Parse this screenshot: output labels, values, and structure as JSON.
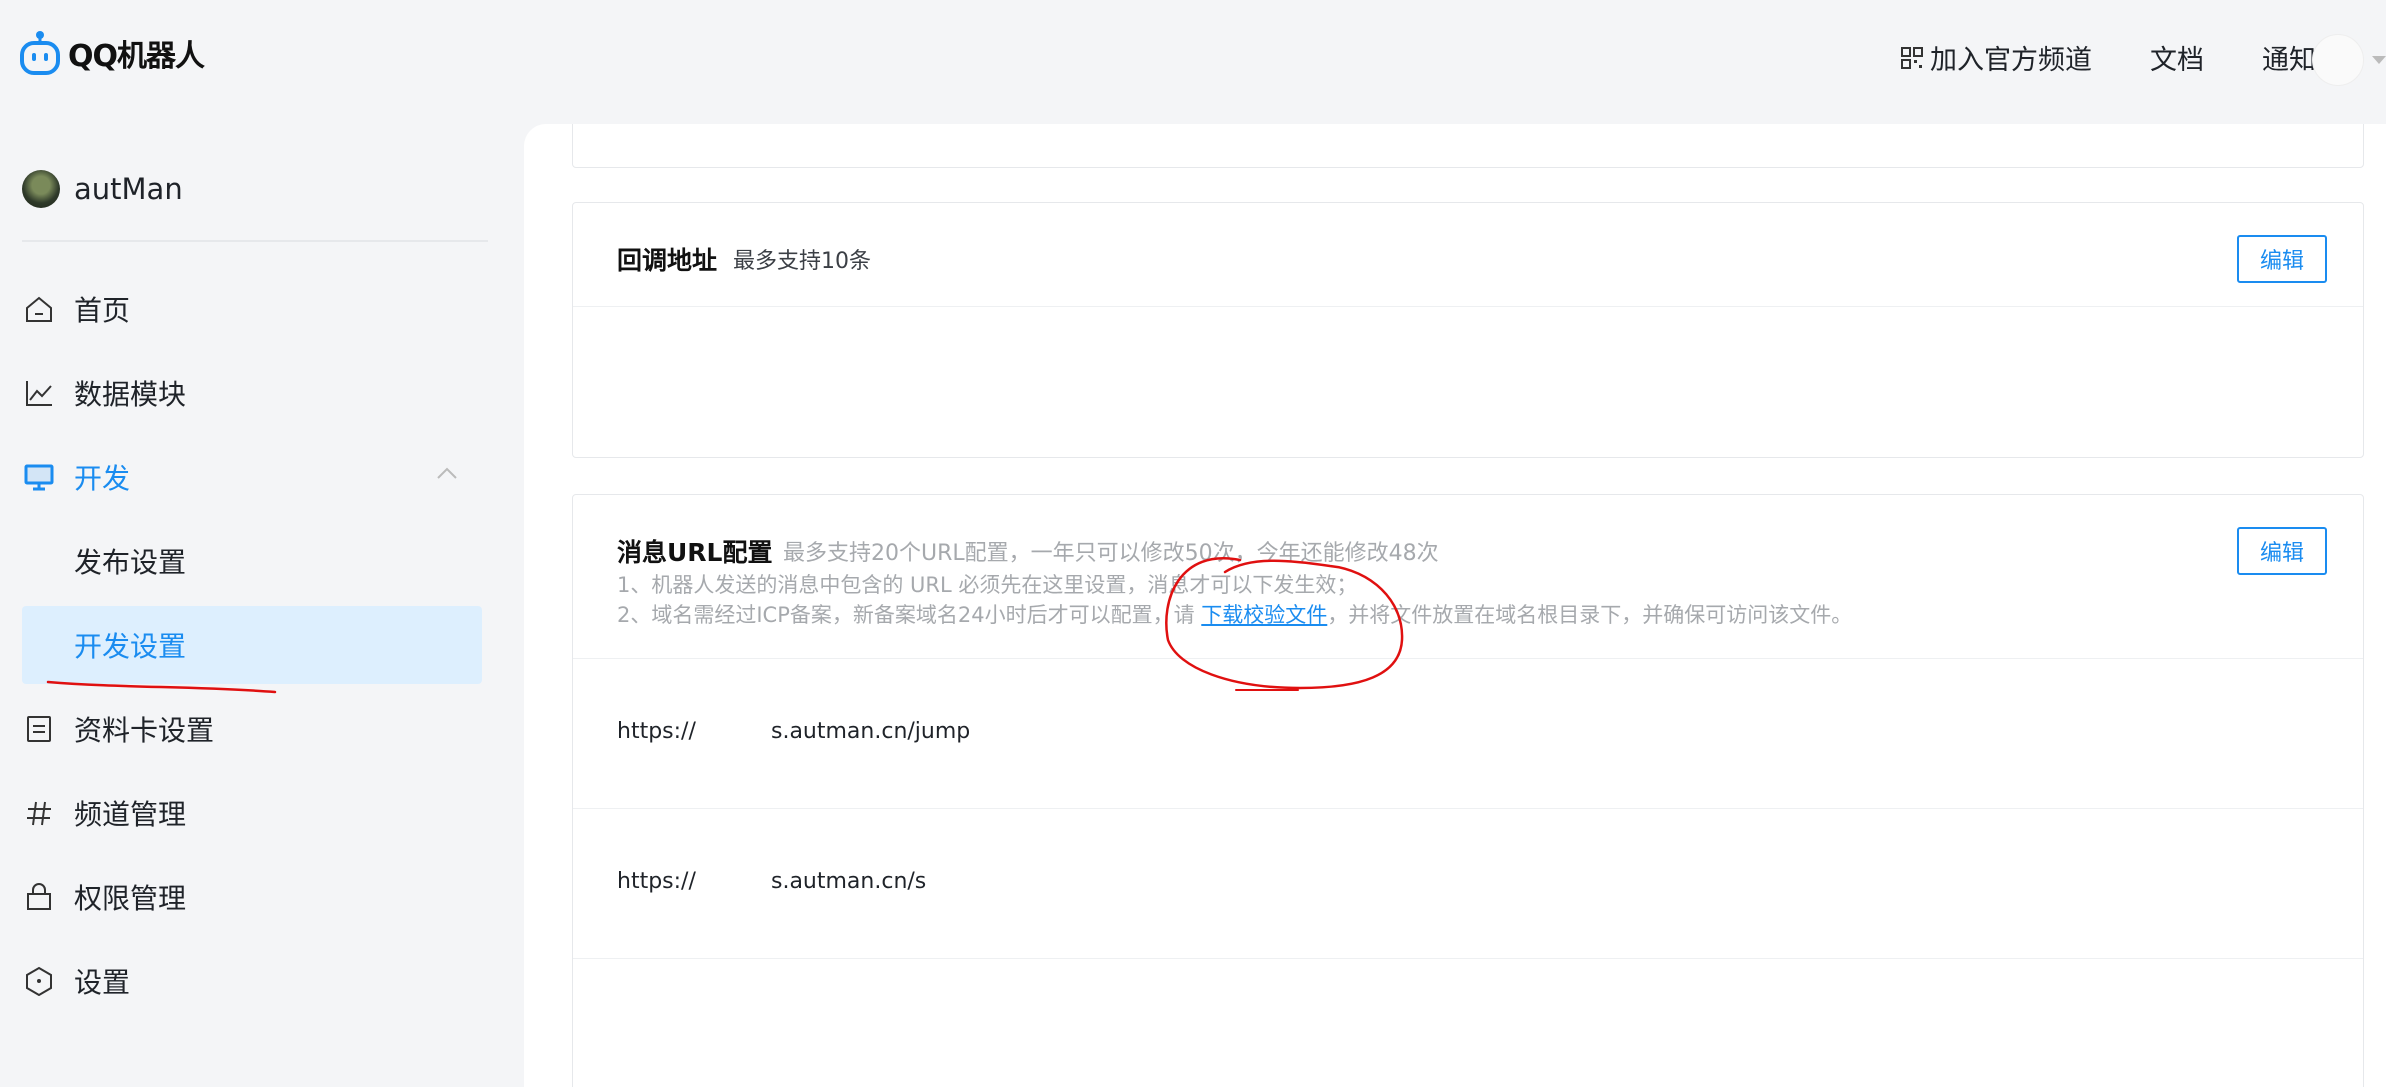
{
  "app": {
    "logo_text": "QQ机器人",
    "nav": {
      "join_channel": "加入官方频道",
      "docs": "文档",
      "notify": "通知"
    }
  },
  "sidebar": {
    "bot_name": "autMan",
    "items": [
      {
        "label": "首页",
        "icon": "home-icon"
      },
      {
        "label": "数据模块",
        "icon": "line-chart-icon"
      },
      {
        "label": "开发",
        "icon": "monitor-icon"
      },
      {
        "label": "发布设置",
        "icon": ""
      },
      {
        "label": "开发设置",
        "icon": ""
      },
      {
        "label": "资料卡设置",
        "icon": "card-icon"
      },
      {
        "label": "频道管理",
        "icon": "hash-icon"
      },
      {
        "label": "权限管理",
        "icon": "lock-icon"
      },
      {
        "label": "设置",
        "icon": "hexagon-icon"
      }
    ]
  },
  "callback": {
    "title": "回调地址",
    "subtitle": "最多支持10条",
    "edit": "编辑"
  },
  "message_url": {
    "title": "消息URL配置",
    "subtitle": "最多支持20个URL配置，一年只可以修改50次，今年还能修改48次",
    "note1": "1、机器人发送的消息中包含的 URL 必须先在这里设置，消息才可以下发生效；",
    "note2_prefix": "2、域名需经过ICP备案，新备案域名24小时后才可以配置，请 ",
    "note2_link": "下载校验文件",
    "note2_suffix": "，并将文件放置在域名根目录下，并确保可访问该文件。",
    "edit": "编辑",
    "urls": [
      {
        "protocol": "https://",
        "host": "s.autman.cn/jump"
      },
      {
        "protocol": "https://",
        "host": "s.autman.cn/s"
      }
    ]
  },
  "colors": {
    "accent": "#1a8cf0",
    "selected_bg": "#ddeffe",
    "annotation": "#e01010"
  }
}
